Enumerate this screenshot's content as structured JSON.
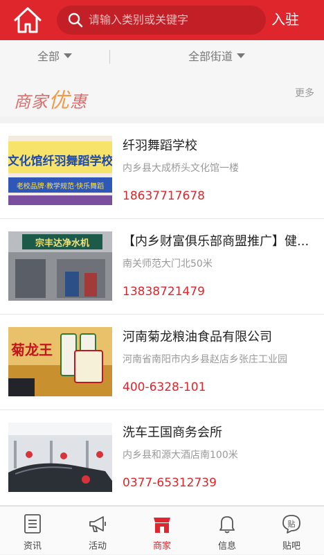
{
  "header": {
    "search_placeholder": "请输入类别或关键字",
    "join_label": "入驻"
  },
  "filters": {
    "all_label": "全部",
    "street_label": "全部街道"
  },
  "promo": {
    "logo_part1": "商家",
    "logo_part2": "优",
    "logo_part3": "惠",
    "more_label": "更多"
  },
  "merchants": [
    {
      "name": "纤羽舞蹈学校",
      "address": "内乡县大成桥头文化馆一楼",
      "phone": "18637717678",
      "thumb_text_top": "文化馆纤羽舞蹈学校",
      "thumb_text_bottom": "老校品牌·教学规范·快乐舞蹈"
    },
    {
      "name": "【内乡财富俱乐部商盟推广】健...",
      "address": "南关师范大门北50米",
      "phone": "13838721479",
      "thumb_text_top": "宗丰达净水机"
    },
    {
      "name": "河南菊龙粮油食品有限公司",
      "address": "河南省南阳市内乡县赵店乡张庄工业园",
      "phone": "400-6328-101",
      "thumb_text_top": "菊龙王"
    },
    {
      "name": "洗车王国商务会所",
      "address": "内乡县和源大酒店南100米",
      "phone": "0377-65312739"
    }
  ],
  "tabs": [
    {
      "label": "资讯",
      "icon": "news-icon"
    },
    {
      "label": "活动",
      "icon": "megaphone-icon"
    },
    {
      "label": "商家",
      "icon": "store-icon",
      "active": true
    },
    {
      "label": "信息",
      "icon": "bell-icon"
    },
    {
      "label": "贴吧",
      "icon": "post-bubble-icon",
      "icon_text": "贴"
    }
  ],
  "colors": {
    "brand": "#e0262d",
    "price": "#e0262d"
  }
}
